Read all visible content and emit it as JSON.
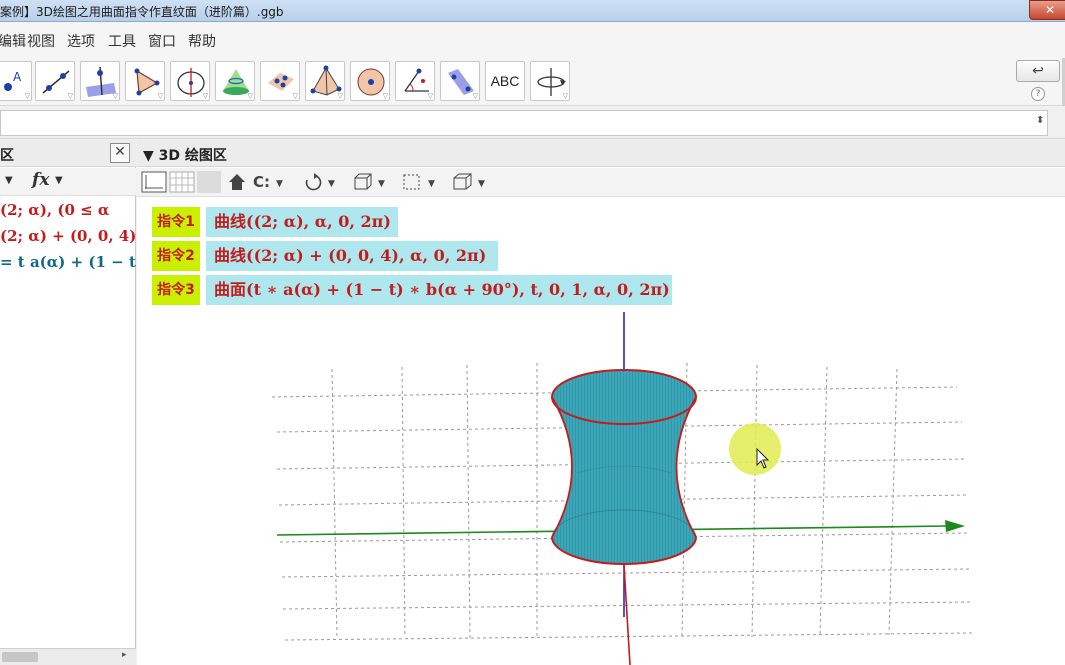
{
  "window": {
    "title": "案例】3D绘图之用曲面指令作直纹面（进阶篇）.ggb",
    "close_glyph": "✕"
  },
  "menu": {
    "items": [
      "编辑",
      "视图",
      "选项",
      "工具",
      "窗口",
      "帮助"
    ]
  },
  "toolbar": {
    "tools": [
      {
        "name": "point-tool",
        "icon": "point-a-icon"
      },
      {
        "name": "line-tool",
        "icon": "line-icon"
      },
      {
        "name": "perpendicular-line-tool",
        "icon": "perpendicular-plane-icon"
      },
      {
        "name": "polygon-tool",
        "icon": "triangle-icon"
      },
      {
        "name": "circle-axis-tool",
        "icon": "circle-axis-icon"
      },
      {
        "name": "intersect-surfaces-tool",
        "icon": "cone-icon"
      },
      {
        "name": "plane-tool",
        "icon": "plane-points-icon"
      },
      {
        "name": "pyramid-tool",
        "icon": "pyramid-icon"
      },
      {
        "name": "sphere-tool",
        "icon": "sphere-icon"
      },
      {
        "name": "angle-tool",
        "icon": "angle-icon"
      },
      {
        "name": "reflect-tool",
        "icon": "reflect-plane-icon"
      },
      {
        "name": "text-tool",
        "icon": "text-abc-icon",
        "label": "ABC"
      },
      {
        "name": "rotate-view-tool",
        "icon": "rotate-view-icon"
      }
    ],
    "undo_glyph": "↩",
    "help_glyph": "?"
  },
  "input_bar": {
    "value": "",
    "spin_glyph": "⬍"
  },
  "algebra_panel": {
    "title": "区",
    "close_glyph": "✕",
    "fx_label": "fx",
    "rows": [
      {
        "text": "(2; α),     (0 ≤ α",
        "color": "red"
      },
      {
        "text": "(2; α) + (0, 0, 4)",
        "color": "red"
      },
      {
        "text": "= t a(α) + (1 − t",
        "color": "teal"
      }
    ]
  },
  "view3d_panel": {
    "title": "▼ 3D 绘图区",
    "commands": [
      {
        "tag": "指令1",
        "text": "曲线((2; α), α, 0, 2π)"
      },
      {
        "tag": "指令2",
        "text": "曲线((2; α) + (0, 0, 4), α, 0, 2π)"
      },
      {
        "tag": "指令3",
        "text": "曲面(t ∗ a(α) + (1 − t) ∗ b(α + 90°), t, 0, 1, α, 0, 2π)"
      }
    ]
  },
  "colors": {
    "surface": "#3aa6b8",
    "curve": "#c41b1b",
    "x_axis": "#1a8a1a",
    "z_axis_top": "#2a2ad0",
    "z_axis_bottom": "#c41b1b",
    "cursor_highlight": "#e0ec50",
    "command_bg": "#aee8ee",
    "command_tag_bg": "#c9f000"
  }
}
